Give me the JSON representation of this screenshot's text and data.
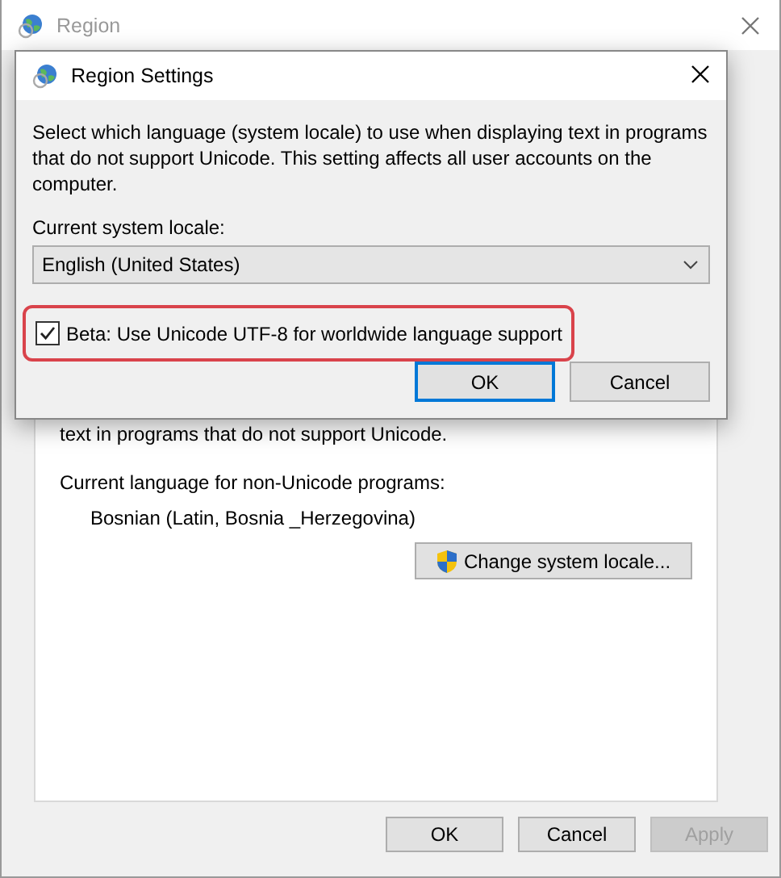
{
  "window": {
    "title": "Region"
  },
  "panel": {
    "covered_text": "text in programs that do not support Unicode.",
    "current_label": "Current language for non-Unicode programs:",
    "current_value": "Bosnian (Latin, Bosnia _Herzegovina)",
    "change_button": "Change system locale..."
  },
  "buttons": [
    {
      "label": "OK",
      "disabled": false
    },
    {
      "label": "Cancel",
      "disabled": false
    },
    {
      "label": "Apply",
      "disabled": true
    }
  ],
  "dialog": {
    "title": "Region Settings",
    "description": "Select which language (system locale) to use when displaying text in programs that do not support Unicode. This setting affects all user accounts on the computer.",
    "locale_label": "Current system locale:",
    "locale_value": "English (United States)",
    "utf8_checkbox": {
      "label": "Beta: Use Unicode UTF-8 for worldwide language support",
      "checked": true,
      "highlighted": true
    },
    "buttons": [
      {
        "label": "OK",
        "default": true
      },
      {
        "label": "Cancel",
        "default": false
      }
    ]
  }
}
